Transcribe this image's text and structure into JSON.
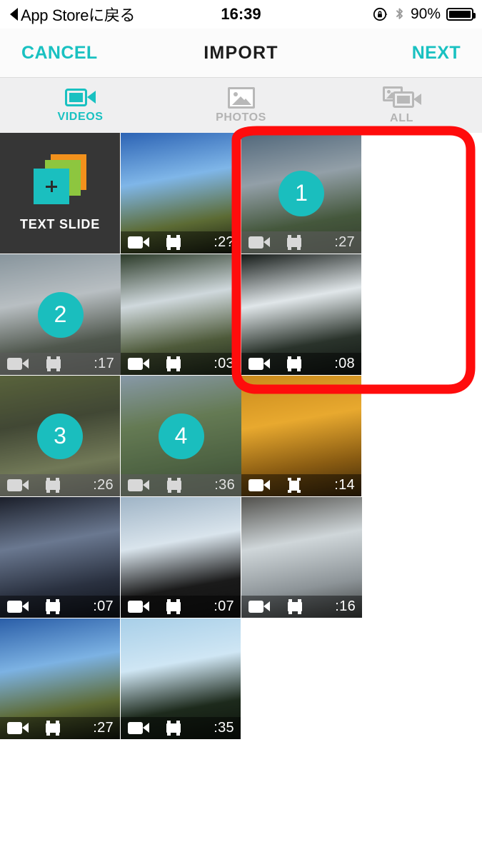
{
  "status_bar": {
    "back_label": "App Storeに戻る",
    "back_icon": "triangle-left-icon",
    "time": "16:39",
    "rotation_lock_icon": "rotation-lock-icon",
    "bluetooth_icon": "bluetooth-icon",
    "battery_percent": "90%",
    "battery_icon": "battery-full-icon"
  },
  "nav_bar": {
    "cancel_label": "CANCEL",
    "title": "IMPORT",
    "next_label": "NEXT",
    "accent_color": "#19C1C1"
  },
  "tabs": [
    {
      "label": "VIDEOS",
      "icon": "video-camera-icon",
      "active": true
    },
    {
      "label": "PHOTOS",
      "icon": "photo-icon",
      "active": false
    },
    {
      "label": "ALL",
      "icon": "photo-and-video-icon",
      "active": false
    }
  ],
  "text_slide": {
    "label": "TEXT SLIDE",
    "icon": "stacked-slides-plus-icon",
    "colors": {
      "orange": "#F2911C",
      "green": "#8DC63F",
      "teal": "#1ABFBF"
    }
  },
  "grid": {
    "items": [
      {
        "kind": "video",
        "duration": ":2?",
        "selection": null,
        "frame_icon": "landscape-frame-icon",
        "thumb": "blue-sky-over-field",
        "c1": "#2c63b4",
        "c2": "#7fb6e8",
        "c3": "#5c6b34",
        "c4": "#14180d"
      },
      {
        "kind": "video",
        "duration": ":27",
        "selection": "1",
        "frame_icon": "landscape-frame-icon",
        "thumb": "dam-spillway-with-trees",
        "c1": "#41617d",
        "c2": "#9fb1bd",
        "c3": "#2f4a23",
        "c4": "#18240f"
      },
      {
        "kind": "video",
        "duration": ":17",
        "selection": "2",
        "frame_icon": "landscape-frame-icon",
        "thumb": "waterfall-weir",
        "c1": "#8fa2ad",
        "c2": "#d5dee3",
        "c3": "#3f4a3c",
        "c4": "#1d2218"
      },
      {
        "kind": "video",
        "duration": ":03",
        "selection": null,
        "frame_icon": "landscape-frame-icon",
        "thumb": "people-at-waterfall",
        "c1": "#2b3a28",
        "c2": "#cfd8dc",
        "c3": "#4e5a3a",
        "c4": "#1a2416"
      },
      {
        "kind": "video",
        "duration": ":08",
        "selection": null,
        "frame_icon": "landscape-frame-icon",
        "thumb": "white-water-cascade",
        "c1": "#151b18",
        "c2": "#e0e6e9",
        "c3": "#2a332b",
        "c4": "#0e1310"
      },
      {
        "kind": "video",
        "duration": ":26",
        "selection": "3",
        "frame_icon": "landscape-frame-icon",
        "thumb": "stone-water-basin",
        "c1": "#4c5a22",
        "c2": "#2a3318",
        "c3": "#6f7a4a",
        "c4": "#2b2f1c"
      },
      {
        "kind": "video",
        "duration": ":36",
        "selection": "4",
        "frame_icon": "landscape-frame-icon",
        "thumb": "rural-valley-fields",
        "c1": "#8fa8bd",
        "c2": "#5d7c45",
        "c3": "#3c5a2c",
        "c4": "#223517"
      },
      {
        "kind": "video",
        "duration": ":14",
        "selection": null,
        "frame_icon": "square-frame-icon",
        "thumb": "yellow-tactile-paving",
        "c1": "#c98a1c",
        "c2": "#e8a92f",
        "c3": "#8a5c12",
        "c4": "#3a2608"
      },
      {
        "kind": "video",
        "duration": ":07",
        "selection": null,
        "frame_icon": "landscape-frame-icon",
        "thumb": "train-station-platform",
        "c1": "#1b1f2a",
        "c2": "#6a7890",
        "c3": "#2a3140",
        "c4": "#0d1016"
      },
      {
        "kind": "video",
        "duration": ":07",
        "selection": null,
        "frame_icon": "landscape-frame-icon",
        "thumb": "snow-on-roof",
        "c1": "#9fb4c6",
        "c2": "#d9e4ec",
        "c3": "#1a1a1a",
        "c4": "#101010"
      },
      {
        "kind": "video",
        "duration": ":16",
        "selection": null,
        "frame_icon": "landscape-frame-icon",
        "thumb": "snowy-corridor",
        "c1": "#51504c",
        "c2": "#cfd6d9",
        "c3": "#8d9498",
        "c4": "#3a3c3a"
      },
      {
        "kind": "video",
        "duration": ":27",
        "selection": null,
        "frame_icon": "landscape-frame-icon",
        "thumb": "blue-sky-grass-field",
        "c1": "#2a5ea8",
        "c2": "#7cb2e3",
        "c3": "#5d6a33",
        "c4": "#11150c"
      },
      {
        "kind": "video",
        "duration": ":35",
        "selection": null,
        "frame_icon": "landscape-frame-icon",
        "thumb": "dusk-sky-with-plane",
        "c1": "#a8cfe8",
        "c2": "#cfe6f4",
        "c3": "#1d2a1c",
        "c4": "#0c120b"
      }
    ]
  },
  "annotation": {
    "shape": "rounded-rectangle-highlight",
    "color": "#FF0C0C",
    "covers": "selected items 1 through 4"
  }
}
